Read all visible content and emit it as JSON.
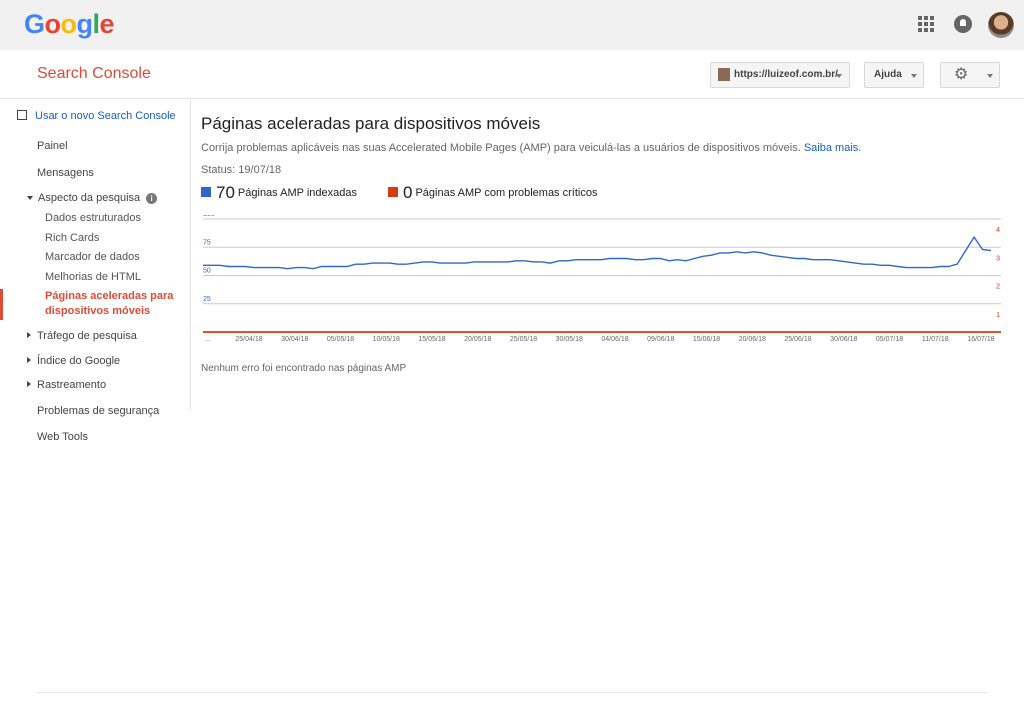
{
  "topbar": {
    "logo": [
      "G",
      "o",
      "o",
      "g",
      "l",
      "e"
    ],
    "icons": [
      "apps-grid-icon",
      "notifications-icon",
      "account-avatar"
    ]
  },
  "header": {
    "title": "Search Console",
    "site": "https://luizeof.com.br/",
    "help_label": "Ajuda",
    "settings_icon": "gear-icon"
  },
  "sidebar": {
    "new_console": "Usar o novo Search Console",
    "painel": "Painel",
    "mensagens": "Mensagens",
    "aspecto": "Aspecto da pesquisa",
    "dados": "Dados estruturados",
    "rich": "Rich Cards",
    "marcador": "Marcador de dados",
    "melhorias": "Melhorias de HTML",
    "amp": "Páginas aceleradas para dispositivos móveis",
    "trafego": "Tráfego de pesquisa",
    "indice": "Índice do Google",
    "rastreamento": "Rastreamento",
    "problemas": "Problemas de segurança",
    "webtools": "Web Tools"
  },
  "main": {
    "title": "Páginas aceleradas para dispositivos móveis",
    "description": "Corrija problemas aplicáveis nas suas Accelerated Mobile Pages (AMP) para veiculá-las a usuários de dispositivos móveis.",
    "learn_more": "Saiba mais.",
    "status": "Status: 19/07/18",
    "indexed_count": "70",
    "indexed_label": "Páginas AMP indexadas",
    "critical_count": "0",
    "critical_label": "Páginas AMP com problemas críticos",
    "note": "Nenhum erro foi encontrado nas páginas AMP"
  },
  "colors": {
    "accent": "#dd4b39",
    "link": "#1a5bc4",
    "series_blue": "#3366cc",
    "series_red": "#dc3912"
  },
  "chart_data": {
    "type": "line",
    "x_tick_labels": [
      "...",
      "25/04/18",
      "30/04/18",
      "05/05/18",
      "10/05/18",
      "15/05/18",
      "20/05/18",
      "25/05/18",
      "30/05/18",
      "04/06/18",
      "09/06/18",
      "15/06/18",
      "20/06/18",
      "25/06/18",
      "30/06/18",
      "05/07/18",
      "11/07/18",
      "16/07/18"
    ],
    "y_left_ticks": [
      "100",
      "75",
      "50",
      "25"
    ],
    "y_right_ticks": [
      "4",
      "3",
      "2",
      "1"
    ],
    "y_left_range": [
      0,
      100
    ],
    "y_right_range": [
      0,
      4
    ],
    "grid": true,
    "series": [
      {
        "name": "Páginas AMP indexadas",
        "axis": "left",
        "color": "#3366cc",
        "values": [
          59,
          59,
          59,
          58,
          58,
          58,
          57,
          57,
          57,
          57,
          56,
          57,
          57,
          56,
          58,
          58,
          58,
          58,
          60,
          60,
          61,
          61,
          61,
          60,
          60,
          61,
          62,
          62,
          61,
          61,
          61,
          61,
          62,
          62,
          62,
          62,
          62,
          63,
          63,
          62,
          62,
          61,
          63,
          63,
          64,
          64,
          64,
          64,
          65,
          65,
          65,
          64,
          64,
          65,
          65,
          63,
          64,
          63,
          65,
          67,
          68,
          70,
          70,
          71,
          70,
          71,
          70,
          68,
          67,
          66,
          65,
          65,
          64,
          64,
          64,
          63,
          62,
          61,
          60,
          60,
          59,
          59,
          58,
          57,
          57,
          57,
          57,
          58,
          58,
          60,
          72,
          84,
          73,
          72
        ]
      },
      {
        "name": "Páginas AMP com problemas críticos",
        "axis": "right",
        "color": "#dc3912",
        "values": [
          0,
          0,
          0,
          0,
          0,
          0,
          0,
          0,
          0,
          0,
          0,
          0,
          0,
          0,
          0,
          0,
          0,
          0,
          0,
          0,
          0,
          0,
          0,
          0,
          0,
          0,
          0,
          0,
          0,
          0,
          0,
          0,
          0,
          0,
          0,
          0,
          0,
          0,
          0,
          0,
          0,
          0,
          0,
          0,
          0,
          0,
          0,
          0,
          0,
          0,
          0,
          0,
          0,
          0,
          0,
          0,
          0,
          0,
          0,
          0,
          0,
          0,
          0,
          0,
          0,
          0,
          0,
          0,
          0,
          0,
          0,
          0,
          0,
          0,
          0,
          0,
          0,
          0,
          0,
          0,
          0,
          0,
          0,
          0,
          0,
          0,
          0,
          0,
          0,
          0,
          0,
          0,
          0,
          0
        ]
      }
    ]
  }
}
